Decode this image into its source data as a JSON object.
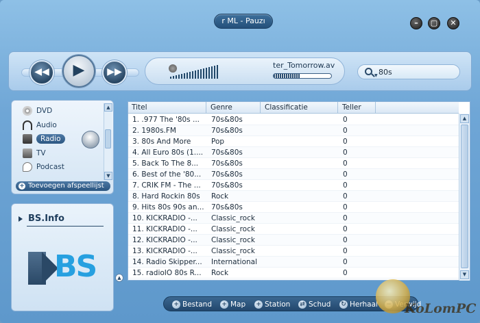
{
  "window": {
    "title": "r ML - Pauzı"
  },
  "window_controls": {
    "minimize": "–",
    "maximize": "▢",
    "close": "✕"
  },
  "transport": {
    "rewind": "◀◀",
    "play": "▶",
    "forward": "▶▶",
    "now_playing": "ter_Tomorrow.av",
    "progress": 0.45
  },
  "search": {
    "value": "80s"
  },
  "library": {
    "items": [
      {
        "label": "DVD",
        "icon": "dvd-icon"
      },
      {
        "label": "Audio",
        "icon": "headphones-icon"
      },
      {
        "label": "Radio",
        "icon": "radio-icon",
        "selected": true
      },
      {
        "label": "TV",
        "icon": "tv-icon"
      },
      {
        "label": "Podcast",
        "icon": "podcast-icon"
      }
    ],
    "add_playlist": "Toevoegen afspeellijst"
  },
  "info": {
    "heading": "BS.Info",
    "logo_text": "BS"
  },
  "playlist": {
    "columns": [
      "Titel",
      "Genre",
      "Classificatie",
      "Teller"
    ],
    "rows": [
      [
        "1. .977 The '80s ...",
        "70s&80s",
        "",
        "0"
      ],
      [
        "2. 1980s.FM",
        "70s&80s",
        "",
        "0"
      ],
      [
        "3. 80s And More",
        "Pop",
        "",
        "0"
      ],
      [
        "4. All Euro 80s (1....",
        "70s&80s",
        "",
        "0"
      ],
      [
        "5. Back To The 8...",
        "70s&80s",
        "",
        "0"
      ],
      [
        "6. Best of the '80...",
        "70s&80s",
        "",
        "0"
      ],
      [
        "7. CRIK FM - The ...",
        "70s&80s",
        "",
        "0"
      ],
      [
        "8. Hard Rockin 80s",
        "Rock",
        "",
        "0"
      ],
      [
        "9. Hits 80s 90s an...",
        "70s&80s",
        "",
        "0"
      ],
      [
        "10. KICKRADIO -...",
        "Classic_rock",
        "",
        "0"
      ],
      [
        "11. KICKRADIO -...",
        "Classic_rock",
        "",
        "0"
      ],
      [
        "12. KICKRADIO -...",
        "Classic_rock",
        "",
        "0"
      ],
      [
        "13. KICKRADIO -...",
        "Classic_rock",
        "",
        "0"
      ],
      [
        "14. Radio Skipper...",
        "International",
        "",
        "0"
      ],
      [
        "15. radioIO 80s R...",
        "Rock",
        "",
        "0"
      ]
    ]
  },
  "bottombar": {
    "items": [
      {
        "label": "Bestand",
        "icon": "plus-icon"
      },
      {
        "label": "Map",
        "icon": "plus-icon"
      },
      {
        "label": "Station",
        "icon": "plus-icon"
      },
      {
        "label": "Schud",
        "icon": "shuffle-icon"
      },
      {
        "label": "Herhaal",
        "icon": "repeat-icon"
      },
      {
        "label": "Verwijd",
        "icon": "remove-icon"
      }
    ]
  },
  "watermark": {
    "text": "KoLomPC"
  }
}
